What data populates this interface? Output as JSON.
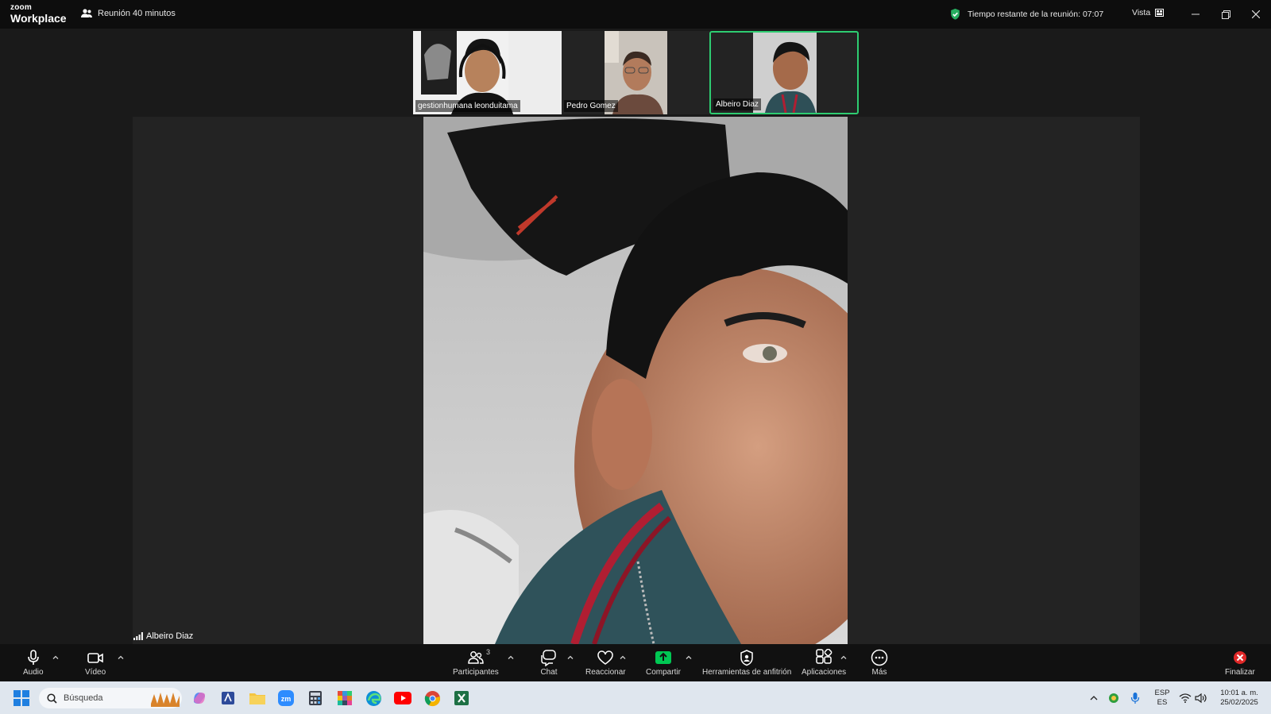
{
  "app": {
    "logo_top": "zoom",
    "logo_bottom": "Workplace",
    "meeting_title": "Reunión 40 minutos",
    "timer_text": "Tiempo restante de la reunión: 07:07",
    "view_label": "Vista"
  },
  "participants": [
    {
      "name": "gestionhumana leonduitama"
    },
    {
      "name": "Pedro Gomez"
    },
    {
      "name": "Albeiro Diaz"
    }
  ],
  "speaker": {
    "name": "Albeiro Diaz"
  },
  "toolbar": {
    "audio": "Audio",
    "video": "Vídeo",
    "participants": "Participantes",
    "participants_count": "3",
    "chat": "Chat",
    "react": "Reaccionar",
    "share": "Compartir",
    "host_tools": "Herramientas de anfitrión",
    "apps": "Aplicaciones",
    "more": "Más",
    "end": "Finalizar"
  },
  "taskbar": {
    "search_placeholder": "Búsqueda",
    "lang_top": "ESP",
    "lang_bottom": "ES",
    "time": "10:01 a. m.",
    "date": "25/02/2025"
  },
  "colors": {
    "active_speaker_border": "#2ecc71",
    "share_green": "#00c853",
    "end_red": "#e02828"
  }
}
